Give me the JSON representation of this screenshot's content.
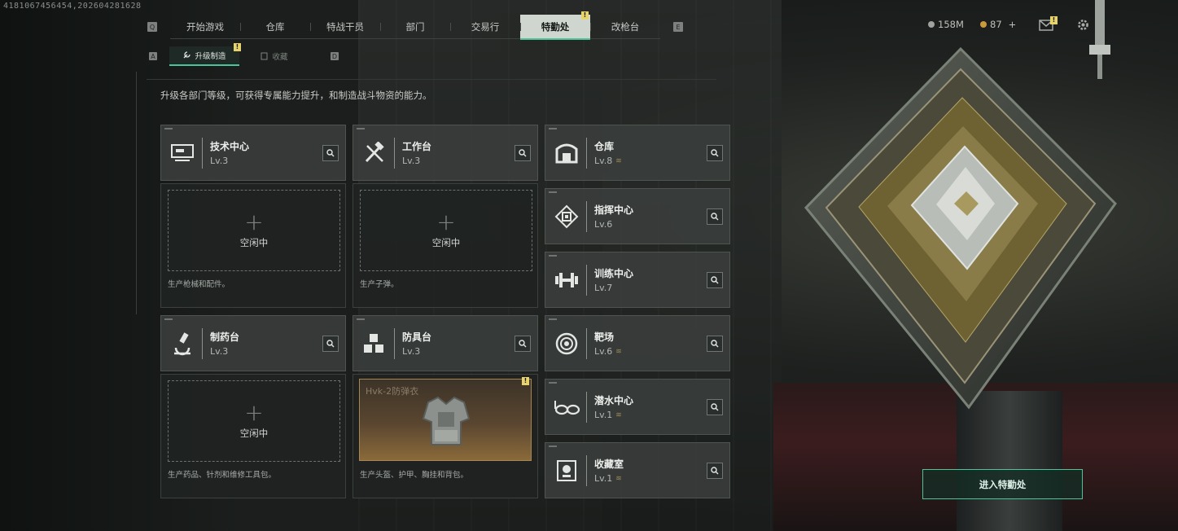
{
  "session_id": "4181067456454,202604281628",
  "nav": {
    "left_key": "Q",
    "right_key": "E",
    "tabs": [
      "开始游戏",
      "仓库",
      "特战干员",
      "部门",
      "交易行",
      "特勤处",
      "改枪台"
    ],
    "active_tab": "特勤处",
    "badge": "!"
  },
  "subnav": {
    "left_key": "A",
    "right_key": "D",
    "tabs": [
      "升级制造",
      "收藏"
    ],
    "active_tab": "升级制造",
    "badge": "!"
  },
  "description": "升级各部门等级，可获得专属能力提升，和制造战斗物资的能力。",
  "production": [
    {
      "name": "技术中心",
      "level": "Lv.3",
      "icon": "computer-icon",
      "slot_status": "空闲中",
      "plus": "+",
      "caption": "生产枪械和配件。"
    },
    {
      "name": "工作台",
      "level": "Lv.3",
      "icon": "tools-icon",
      "slot_status": "空闲中",
      "plus": "+",
      "caption": "生产子弹。"
    },
    {
      "name": "制药台",
      "level": "Lv.3",
      "icon": "microscope-icon",
      "slot_status": "空闲中",
      "plus": "+",
      "caption": "生产药品、针剂和维修工具包。"
    },
    {
      "name": "防具台",
      "level": "Lv.3",
      "icon": "cubes-icon",
      "item_name": "Hvk-2防弹衣",
      "item_badge": "!",
      "caption": "生产头盔、护甲、胸挂和背包。"
    }
  ],
  "facilities": [
    {
      "name": "仓库",
      "level": "Lv.8",
      "icon": "warehouse-icon",
      "upgradeable": true
    },
    {
      "name": "指挥中心",
      "level": "Lv.6",
      "icon": "chip-icon",
      "upgradeable": false
    },
    {
      "name": "训练中心",
      "level": "Lv.7",
      "icon": "dumbbell-icon",
      "upgradeable": false
    },
    {
      "name": "靶场",
      "level": "Lv.6",
      "icon": "target-icon",
      "upgradeable": true
    },
    {
      "name": "潜水中心",
      "level": "Lv.1",
      "icon": "goggles-icon",
      "upgradeable": true
    },
    {
      "name": "收藏室",
      "level": "Lv.1",
      "icon": "trophy-icon",
      "upgradeable": true
    }
  ],
  "upgrade_glyph": "≋",
  "currency": {
    "silver": "158M",
    "gold": "87",
    "gold_plus": "+"
  },
  "enter_button": "进入特勤处",
  "colors": {
    "accent": "#4cc49a",
    "badge": "#e8d36a"
  }
}
